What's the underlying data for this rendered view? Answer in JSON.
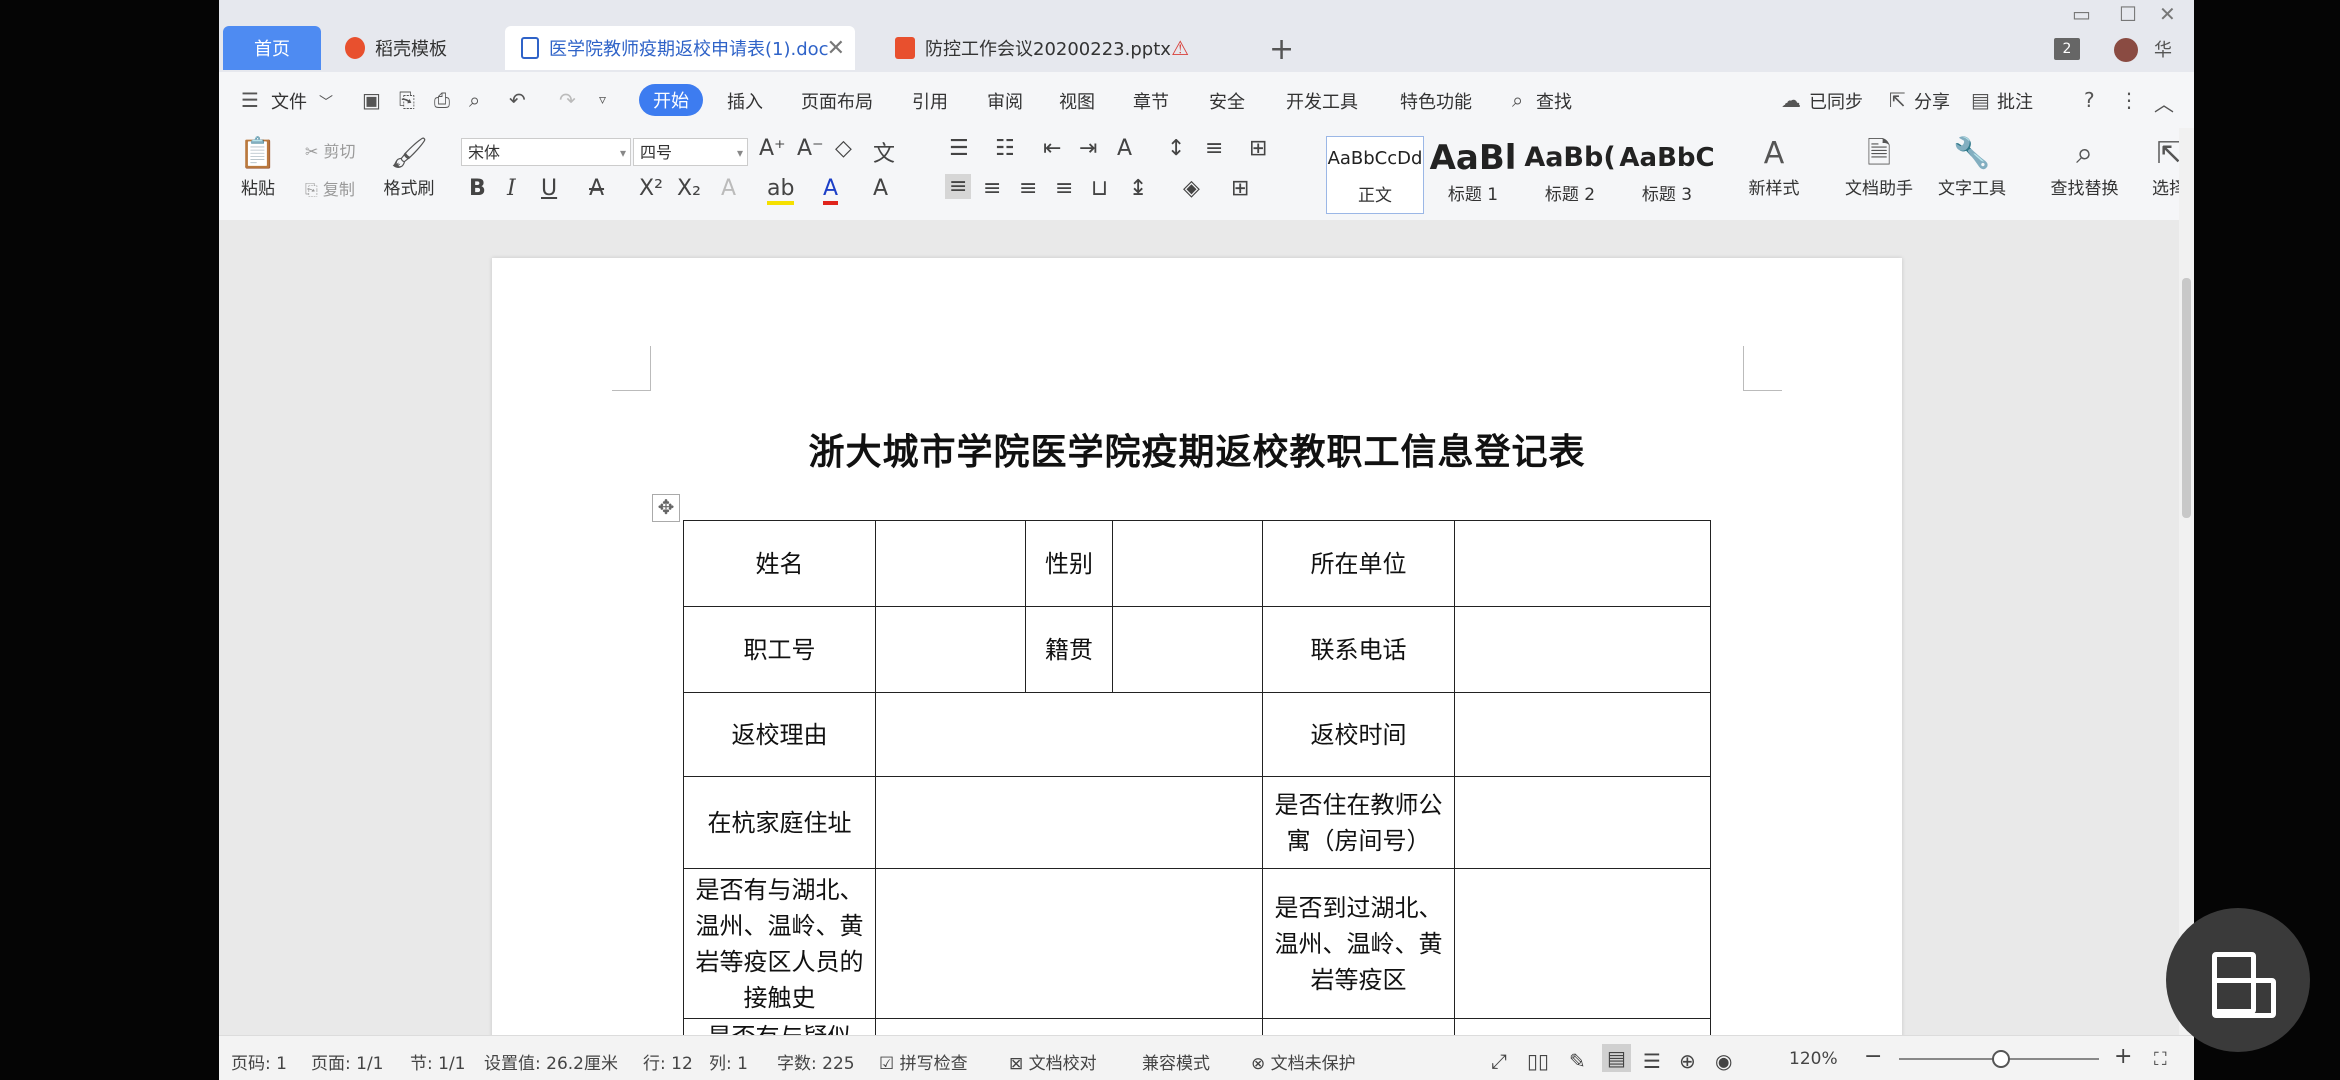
{
  "tabs": {
    "home": "首页",
    "t1": "稻壳模板",
    "t2": "医学院教师疫期返校申请表(1).doc",
    "t3": "防控工作会议20200223.pptx",
    "badge": "2",
    "user": "华"
  },
  "menu": {
    "file": "文件",
    "start": "开始",
    "insert": "插入",
    "layout": "页面布局",
    "ref": "引用",
    "review": "审阅",
    "view": "视图",
    "chapter": "章节",
    "security": "安全",
    "devtools": "开发工具",
    "features": "特色功能",
    "find": "查找",
    "sync": "已同步",
    "share": "分享",
    "comment": "批注"
  },
  "ribbon": {
    "paste": "粘贴",
    "cut": "剪切",
    "copy": "复制",
    "format_painter": "格式刷",
    "font": "宋体",
    "size": "四号",
    "styles": [
      {
        "sample": "AaBbCcDd",
        "label": "正文"
      },
      {
        "sample": "AaBl",
        "label": "标题 1"
      },
      {
        "sample": "AaBb(",
        "label": "标题 2"
      },
      {
        "sample": "AaBbC",
        "label": "标题 3"
      }
    ],
    "new_style": "新样式",
    "doc_helper": "文档助手",
    "text_tools": "文字工具",
    "find_replace": "查找替换",
    "select": "选择"
  },
  "document": {
    "title": "浙大城市学院医学院疫期返校教职工信息登记表",
    "cells": {
      "name": "姓名",
      "gender": "性别",
      "unit": "所在单位",
      "staff_no": "职工号",
      "hometown": "籍贯",
      "phone": "联系电话",
      "reason": "返校理由",
      "return_time": "返校时间",
      "address": "在杭家庭住址",
      "apartment": "是否住在教师公寓（房间号）",
      "contact_hist": "是否有与湖北、温州、温岭、黄岩等疫区人员的接触史",
      "visited": "是否到过湖北、温州、温岭、黄岩等疫区",
      "partial": "是否有与疑似"
    }
  },
  "status": {
    "page_code": "页码: 1",
    "pages": "页面: 1/1",
    "section": "节: 1/1",
    "setting": "设置值: 26.2厘米",
    "row": "行: 12",
    "col": "列: 1",
    "words": "字数: 225",
    "spell": "拼写检查",
    "proof": "文档校对",
    "compat": "兼容模式",
    "unprotected": "文档未保护",
    "zoom": "120%"
  }
}
